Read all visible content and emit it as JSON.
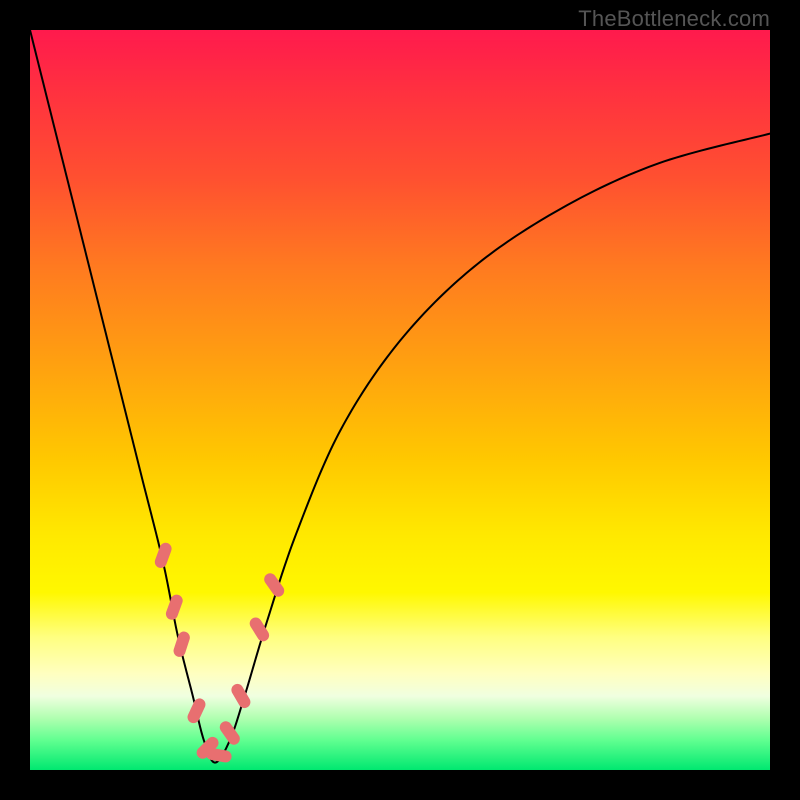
{
  "attribution": "TheBottleneck.com",
  "chart_data": {
    "type": "line",
    "title": "",
    "xlabel": "",
    "ylabel": "",
    "xlim": [
      0,
      100
    ],
    "ylim": [
      0,
      100
    ],
    "series": [
      {
        "name": "bottleneck-curve",
        "x": [
          0,
          4,
          8,
          12,
          15,
          18,
          20,
          22,
          23.5,
          25,
          27,
          29,
          32,
          36,
          42,
          50,
          60,
          72,
          85,
          100
        ],
        "y": [
          100,
          84,
          68,
          52,
          40,
          28,
          18,
          10,
          4,
          1,
          4,
          10,
          20,
          32,
          46,
          58,
          68,
          76,
          82,
          86
        ]
      }
    ],
    "markers": {
      "name": "highlight-points",
      "style": "pill",
      "color": "#e86f70",
      "points": [
        {
          "x": 18,
          "y": 29,
          "angle": -70
        },
        {
          "x": 19.5,
          "y": 22,
          "angle": -70
        },
        {
          "x": 20.5,
          "y": 17,
          "angle": -72
        },
        {
          "x": 22.5,
          "y": 8,
          "angle": -65
        },
        {
          "x": 24,
          "y": 3,
          "angle": -45
        },
        {
          "x": 25.5,
          "y": 2,
          "angle": 10
        },
        {
          "x": 27,
          "y": 5,
          "angle": 55
        },
        {
          "x": 28.5,
          "y": 10,
          "angle": 60
        },
        {
          "x": 31,
          "y": 19,
          "angle": 58
        },
        {
          "x": 33,
          "y": 25,
          "angle": 55
        }
      ]
    }
  }
}
